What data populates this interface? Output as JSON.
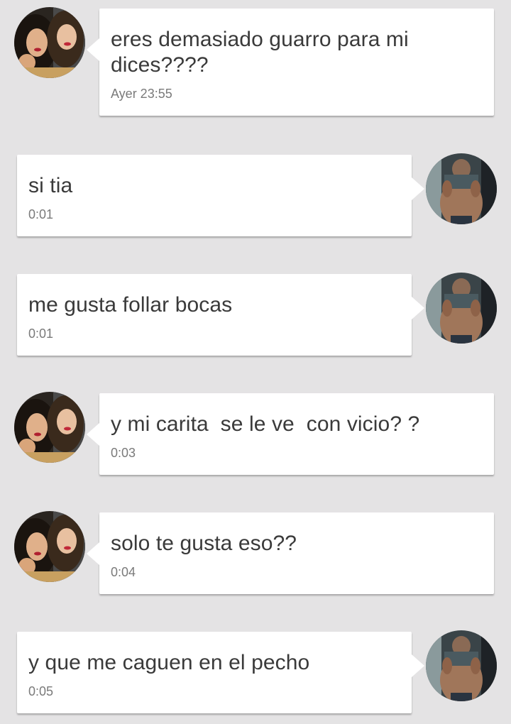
{
  "colors": {
    "background": "#e4e3e4",
    "bubble": "#ffffff",
    "text": "#3a3a3a",
    "timestamp": "#7a7a7a"
  },
  "messages": [
    {
      "side": "incoming",
      "avatar_icon": "contact-avatar-two-women",
      "text": "eres demasiado guarro para mi dices????",
      "time": "Ayer 23:55"
    },
    {
      "side": "outgoing",
      "avatar_icon": "user-avatar-shirtless-man",
      "text": "si tia",
      "time": "0:01"
    },
    {
      "side": "outgoing",
      "avatar_icon": "user-avatar-shirtless-man",
      "text": "me gusta follar bocas",
      "time": "0:01"
    },
    {
      "side": "incoming",
      "avatar_icon": "contact-avatar-two-women",
      "text": "y mi carita  se le ve  con vicio? ?",
      "time": "0:03"
    },
    {
      "side": "incoming",
      "avatar_icon": "contact-avatar-two-women",
      "text": "solo te gusta eso??",
      "time": "0:04"
    },
    {
      "side": "outgoing",
      "avatar_icon": "user-avatar-shirtless-man",
      "text": "y que me caguen en el pecho",
      "time": "0:05"
    }
  ]
}
